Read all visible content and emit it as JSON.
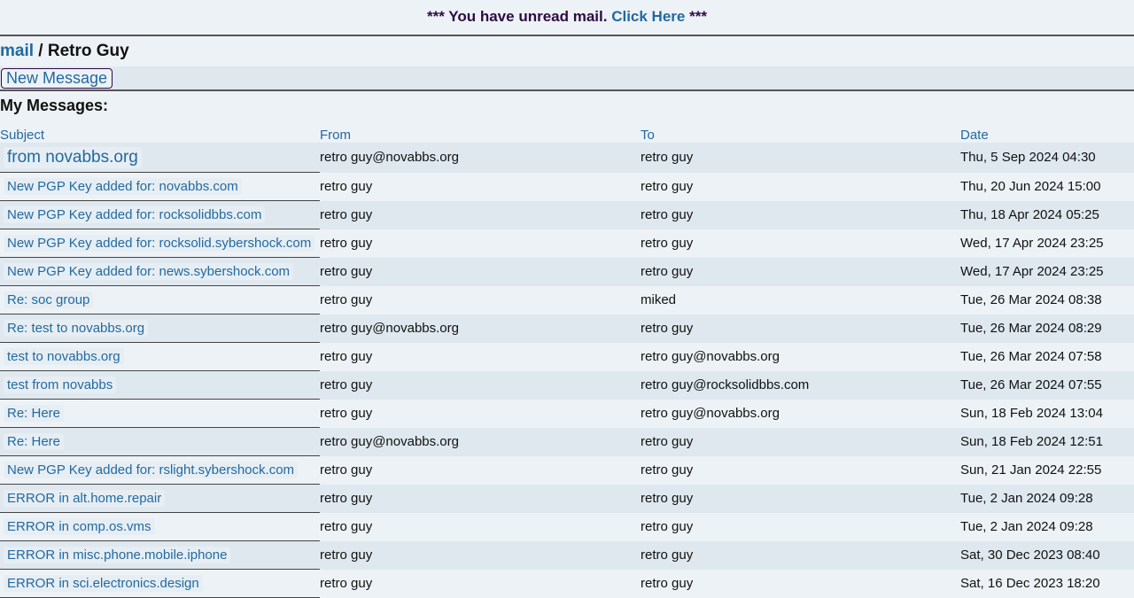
{
  "banner": {
    "prefix": "*** You have unread mail.",
    "link": "Click Here",
    "suffix": "***"
  },
  "breadcrumb": {
    "root": "mail",
    "separator": " / ",
    "current": "Retro Guy"
  },
  "toolbar": {
    "new_message_label": "New Message"
  },
  "section_title": "My Messages:",
  "columns": [
    "Subject",
    "From",
    "To",
    "Date"
  ],
  "messages": [
    {
      "subject": "from novabbs.org",
      "from": "retro guy@novabbs.org",
      "to": "retro guy",
      "date": "Thu, 5 Sep 2024 04:30"
    },
    {
      "subject": "New PGP Key added for: novabbs.com",
      "from": "retro guy",
      "to": "retro guy",
      "date": "Thu, 20 Jun 2024 15:00"
    },
    {
      "subject": "New PGP Key added for: rocksolidbbs.com",
      "from": "retro guy",
      "to": "retro guy",
      "date": "Thu, 18 Apr 2024 05:25"
    },
    {
      "subject": "New PGP Key added for: rocksolid.sybershock.com",
      "from": "retro guy",
      "to": "retro guy",
      "date": "Wed, 17 Apr 2024 23:25"
    },
    {
      "subject": "New PGP Key added for: news.sybershock.com",
      "from": "retro guy",
      "to": "retro guy",
      "date": "Wed, 17 Apr 2024 23:25"
    },
    {
      "subject": "Re: soc group",
      "from": "retro guy",
      "to": "miked",
      "date": "Tue, 26 Mar 2024 08:38"
    },
    {
      "subject": "Re: test to novabbs.org",
      "from": "retro guy@novabbs.org",
      "to": "retro guy",
      "date": "Tue, 26 Mar 2024 08:29"
    },
    {
      "subject": "test to novabbs.org",
      "from": "retro guy",
      "to": "retro guy@novabbs.org",
      "date": "Tue, 26 Mar 2024 07:58"
    },
    {
      "subject": "test from novabbs",
      "from": "retro guy",
      "to": "retro guy@rocksolidbbs.com",
      "date": "Tue, 26 Mar 2024 07:55"
    },
    {
      "subject": "Re: Here",
      "from": "retro guy",
      "to": "retro guy@novabbs.org",
      "date": "Sun, 18 Feb 2024 13:04"
    },
    {
      "subject": "Re: Here",
      "from": "retro guy@novabbs.org",
      "to": "retro guy",
      "date": "Sun, 18 Feb 2024 12:51"
    },
    {
      "subject": "New PGP Key added for: rslight.sybershock.com",
      "from": "retro guy",
      "to": "retro guy",
      "date": "Sun, 21 Jan 2024 22:55"
    },
    {
      "subject": "ERROR in alt.home.repair",
      "from": "retro guy",
      "to": "retro guy",
      "date": "Tue, 2 Jan 2024 09:28"
    },
    {
      "subject": "ERROR in comp.os.vms",
      "from": "retro guy",
      "to": "retro guy",
      "date": "Tue, 2 Jan 2024 09:28"
    },
    {
      "subject": "ERROR in misc.phone.mobile.iphone",
      "from": "retro guy",
      "to": "retro guy",
      "date": "Sat, 30 Dec 2023 08:40"
    },
    {
      "subject": "ERROR in sci.electronics.design",
      "from": "retro guy",
      "to": "retro guy",
      "date": "Sat, 16 Dec 2023 18:20"
    }
  ]
}
